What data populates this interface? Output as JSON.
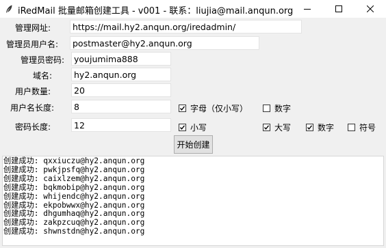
{
  "window": {
    "title": "iRedMail 批量邮箱创建工具 - v001 - 联系：liujia@mail.anqun.org",
    "app_icon": "feather-icon",
    "controls": [
      "minimize-icon",
      "maximize-icon",
      "close-icon"
    ]
  },
  "form": {
    "admin_url": {
      "label": "管理网址:",
      "value": "https://mail.hy2.anqun.org/iredadmin/"
    },
    "admin_user": {
      "label": "管理员用户名:",
      "value": "postmaster@hy2.anqun.org"
    },
    "admin_password": {
      "label": "管理员密码:",
      "value": "youjumima888"
    },
    "domain": {
      "label": "域名:",
      "value": "hy2.anqun.org"
    },
    "user_count": {
      "label": "用户数量:",
      "value": "20"
    },
    "username_length": {
      "label": "用户名长度:",
      "value": "8"
    },
    "password_length": {
      "label": "密码长度:",
      "value": "12"
    }
  },
  "username_options": {
    "letters": {
      "label": "字母（仅小写）",
      "checked": true
    },
    "digits": {
      "label": "数字",
      "checked": false
    }
  },
  "password_options": {
    "lowercase": {
      "label": "小写",
      "checked": true
    },
    "uppercase": {
      "label": "大写",
      "checked": true
    },
    "digits": {
      "label": "数字",
      "checked": true
    },
    "symbols": {
      "label": "符号",
      "checked": false
    }
  },
  "start_button": {
    "label": "开始创建"
  },
  "log": {
    "lines": [
      "创建成功: qxxiuczu@hy2.anqun.org",
      "创建成功: pwkjpsfq@hy2.anqun.org",
      "创建成功: caixlzem@hy2.anqun.org",
      "创建成功: bqkmobip@hy2.anqun.org",
      "创建成功: whijendc@hy2.anqun.org",
      "创建成功: ekpobwwx@hy2.anqun.org",
      "创建成功: dhgumhaq@hy2.anqun.org",
      "创建成功: zakpzcuq@hy2.anqun.org",
      "创建成功: shwnstdn@hy2.anqun.org"
    ]
  }
}
